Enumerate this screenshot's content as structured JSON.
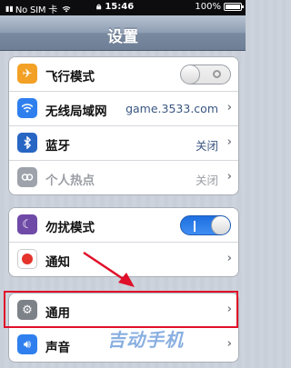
{
  "status_bar": {
    "carrier": "No SIM 卡",
    "time": "15:46",
    "battery": "100%"
  },
  "nav": {
    "title": "设置"
  },
  "group1": [
    {
      "label": "飞行模式",
      "icon": "airplane-icon",
      "color": "#f2a126",
      "control": "toggle-off"
    },
    {
      "label": "无线局域网",
      "icon": "wifi-icon",
      "color": "#2f80ee",
      "value": "game.3533.com"
    },
    {
      "label": "蓝牙",
      "icon": "bluetooth-icon",
      "color": "#2866c4",
      "value": "关闭"
    },
    {
      "label": "个人热点",
      "icon": "hotspot-icon",
      "color": "#9ea3ab",
      "disabled": true,
      "value": "关闭"
    }
  ],
  "group2": [
    {
      "label": "勿扰模式",
      "icon": "moon-icon",
      "color": "#6f4aa7",
      "control": "toggle-on"
    },
    {
      "label": "通知",
      "icon": "notification-icon",
      "color": "#e5342b"
    }
  ],
  "group3": [
    {
      "label": "通用",
      "icon": "gear-icon",
      "color": "#7d8188"
    },
    {
      "label": "声音",
      "icon": "speaker-icon",
      "color": "#2f80ee"
    }
  ],
  "annotation": {
    "color": "#e0102a"
  },
  "watermark": "吉动手机"
}
